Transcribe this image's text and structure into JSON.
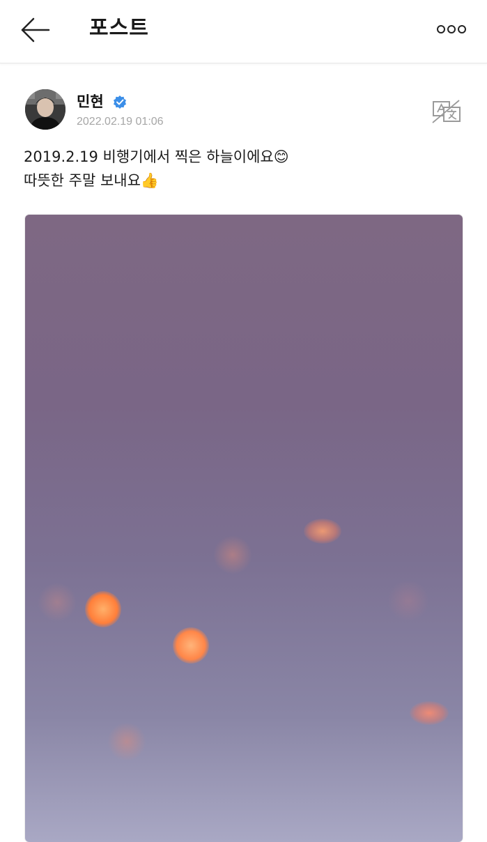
{
  "header": {
    "title": "포스트",
    "back_icon": "arrow-left-icon",
    "more_icon": "more-horizontal-icon"
  },
  "post": {
    "author": "민현",
    "verified": true,
    "verified_color": "#3b8ee8",
    "timestamp": "2022.02.19 01:06",
    "translate_icon": "translate-icon",
    "text_lines": [
      "2019.2.19 비행기에서 찍은 하늘이에요😊",
      "따뜻한 주말 보내요👍"
    ],
    "image_icon": "sky-photo"
  },
  "colors": {
    "header_bg": "#ffffff",
    "timestamp": "#a6a6a6",
    "sky_top": "#7e6883",
    "sky_bottom": "#a9a8c4",
    "bokeh": "#ff7a3c"
  }
}
